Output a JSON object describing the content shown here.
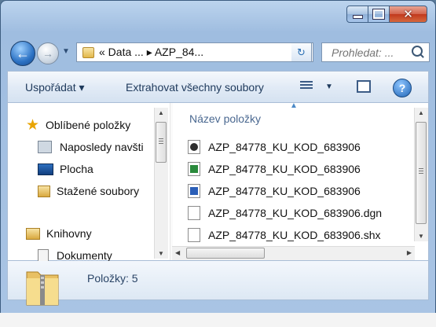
{
  "window": {
    "caption_buttons": {
      "minimize": "minimize",
      "maximize": "maximize",
      "close": "✕"
    }
  },
  "address_bar": {
    "breadcrumb": "« Data ... ▸ AZP_84...",
    "search_placeholder": "Prohledat: ..."
  },
  "toolbar": {
    "organize_label": "Uspořádat ▾",
    "extract_label": "Extrahovat všechny soubory",
    "help_label": "?"
  },
  "navigation": {
    "items": [
      {
        "label": "Oblíbené položky",
        "icon": "star-icon"
      },
      {
        "label": "Naposledy navšti",
        "icon": "recent-places-icon"
      },
      {
        "label": "Plocha",
        "icon": "desktop-icon"
      },
      {
        "label": "Stažené soubory",
        "icon": "downloads-folder-icon"
      },
      {
        "label": "Knihovny",
        "icon": "libraries-icon"
      },
      {
        "label": "Dokumenty",
        "icon": "documents-icon"
      }
    ]
  },
  "file_list": {
    "column_header": "Název položky",
    "files": [
      {
        "name": "AZP_84778_KU_KOD_683906",
        "icon": "dwg-file-icon",
        "color": "#2e2e2e"
      },
      {
        "name": "AZP_84778_KU_KOD_683906",
        "icon": "excel-file-icon",
        "color": "#2a8a3c"
      },
      {
        "name": "AZP_84778_KU_KOD_683906",
        "icon": "word-file-icon",
        "color": "#2b5fb8"
      },
      {
        "name": "AZP_84778_KU_KOD_683906.dgn",
        "icon": "generic-file-icon",
        "color": "#ffffff"
      },
      {
        "name": "AZP_84778_KU_KOD_683906.shx",
        "icon": "generic-file-icon",
        "color": "#ffffff"
      }
    ]
  },
  "details_pane": {
    "item_count": "Položky: 5"
  }
}
